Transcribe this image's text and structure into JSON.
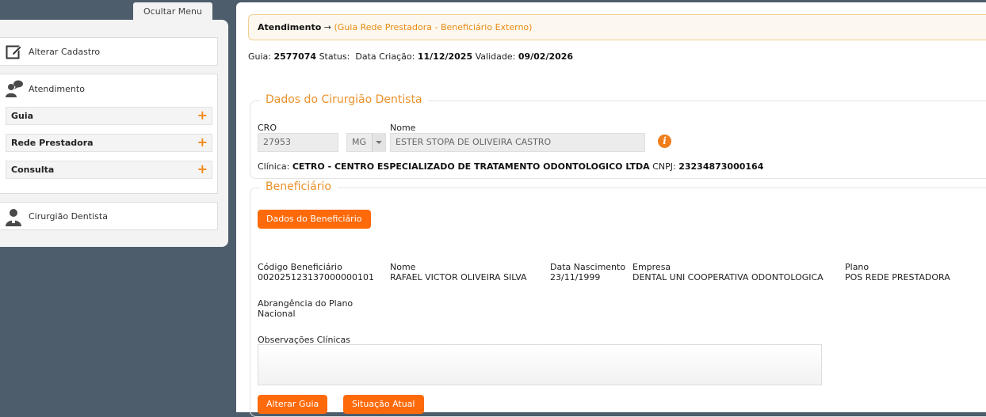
{
  "menu": {
    "hide_label": "Ocultar Menu",
    "alterar_cadastro": "Alterar Cadastro",
    "atendimento": "Atendimento",
    "sub_items": [
      {
        "label": "Guia"
      },
      {
        "label": "Rede Prestadora"
      },
      {
        "label": "Consulta"
      }
    ],
    "cirurgiao_dentista": "Cirurgião Dentista",
    "plus_glyph": "+"
  },
  "breadcrumb": {
    "main": "Atendimento",
    "arrow": " → ",
    "sub": "(Guia Rede Prestadora - Beneficiário Externo)"
  },
  "guia_info": {
    "guia_label": "Guia:",
    "guia_value": "2577074",
    "status_label": "Status:",
    "data_criacao_label": "Data Criação:",
    "data_criacao_value": "11/12/2025",
    "validade_label": "Validade:",
    "validade_value": "09/02/2026"
  },
  "dentista": {
    "legend": "Dados do Cirurgião Dentista",
    "cro_label": "CRO",
    "cro_value": "27953",
    "uf_value": "MG",
    "nome_label": "Nome",
    "nome_value": "ESTER STOPA DE OLIVEIRA CASTRO",
    "info_glyph": "i",
    "clinica_label": "Clínica:",
    "clinica_value": "CETRO - CENTRO ESPECIALIZADO DE TRATAMENTO ODONTOLOGICO LTDA",
    "cnpj_label": "CNPJ:",
    "cnpj_value": "23234873000164"
  },
  "beneficiario": {
    "legend": "Beneficiário",
    "dados_button": "Dados do Beneficiário",
    "codigo_label": "Código Beneficiário",
    "codigo_value": "00202512313700000010​1",
    "nome_label": "Nome",
    "nome_value": "RAFAEL VICTOR OLIVEIRA SILVA",
    "nascimento_label": "Data Nascimento",
    "nascimento_value": "23/11/1999",
    "empresa_label": "Empresa",
    "empresa_value": "DENTAL UNI COOPERATIVA ODONTOLOGICA",
    "plano_label": "Plano",
    "plano_value": "POS REDE PRESTADORA",
    "abrangencia_label": "Abrangência do Plano",
    "abrangencia_value": "Nacional",
    "observacoes_label": "Observações Clínicas"
  },
  "actions": {
    "alterar_guia": "Alterar Guia",
    "situacao_atual": "Situação Atual"
  },
  "colors": {
    "accent": "#fe6a0a",
    "legend": "#e9912a",
    "sidebar_bg": "#4d5d6b"
  }
}
